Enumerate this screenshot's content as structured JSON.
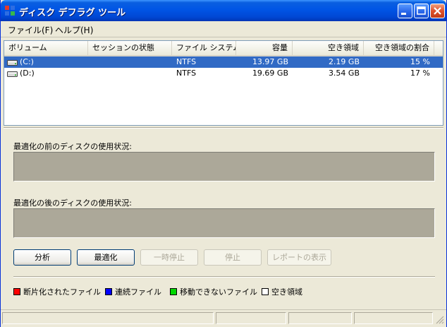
{
  "window": {
    "title": "ディスク デフラグ ツール"
  },
  "menu": [
    {
      "label": "ファイル(F)"
    },
    {
      "label": "ヘルプ(H)"
    }
  ],
  "columns": [
    "ボリューム",
    "セッションの状態",
    "ファイル システム",
    "容量",
    "空き領域",
    "空き領域の割合"
  ],
  "volumes": [
    {
      "name": "(C:)",
      "status": "",
      "fs": "NTFS",
      "capacity": "13.97 GB",
      "free": "2.19 GB",
      "percent": "15 %",
      "selected": true,
      "icon": "drive-icon"
    },
    {
      "name": "(D:)",
      "status": "",
      "fs": "NTFS",
      "capacity": "19.69 GB",
      "free": "3.54 GB",
      "percent": "17 %",
      "selected": false,
      "icon": "drive-icon"
    }
  ],
  "before_label": "最適化の前のディスクの使用状況:",
  "after_label": "最適化の後のディスクの使用状況:",
  "buttons": [
    {
      "label": "分析",
      "enabled": true
    },
    {
      "label": "最適化",
      "enabled": true
    },
    {
      "label": "一時停止",
      "enabled": false
    },
    {
      "label": "停止",
      "enabled": false
    },
    {
      "label": "レポートの表示",
      "enabled": false
    }
  ],
  "legend": [
    {
      "label": "断片化されたファイル",
      "color": "#ff0000"
    },
    {
      "label": "連続ファイル",
      "color": "#0000ff"
    },
    {
      "label": "移動できないファイル",
      "color": "#00d800"
    },
    {
      "label": "空き領域",
      "color": "#ffffff"
    }
  ],
  "colors": {
    "titlebar": "#0055e5",
    "selection": "#316ac5",
    "display_area": "#aca899"
  }
}
